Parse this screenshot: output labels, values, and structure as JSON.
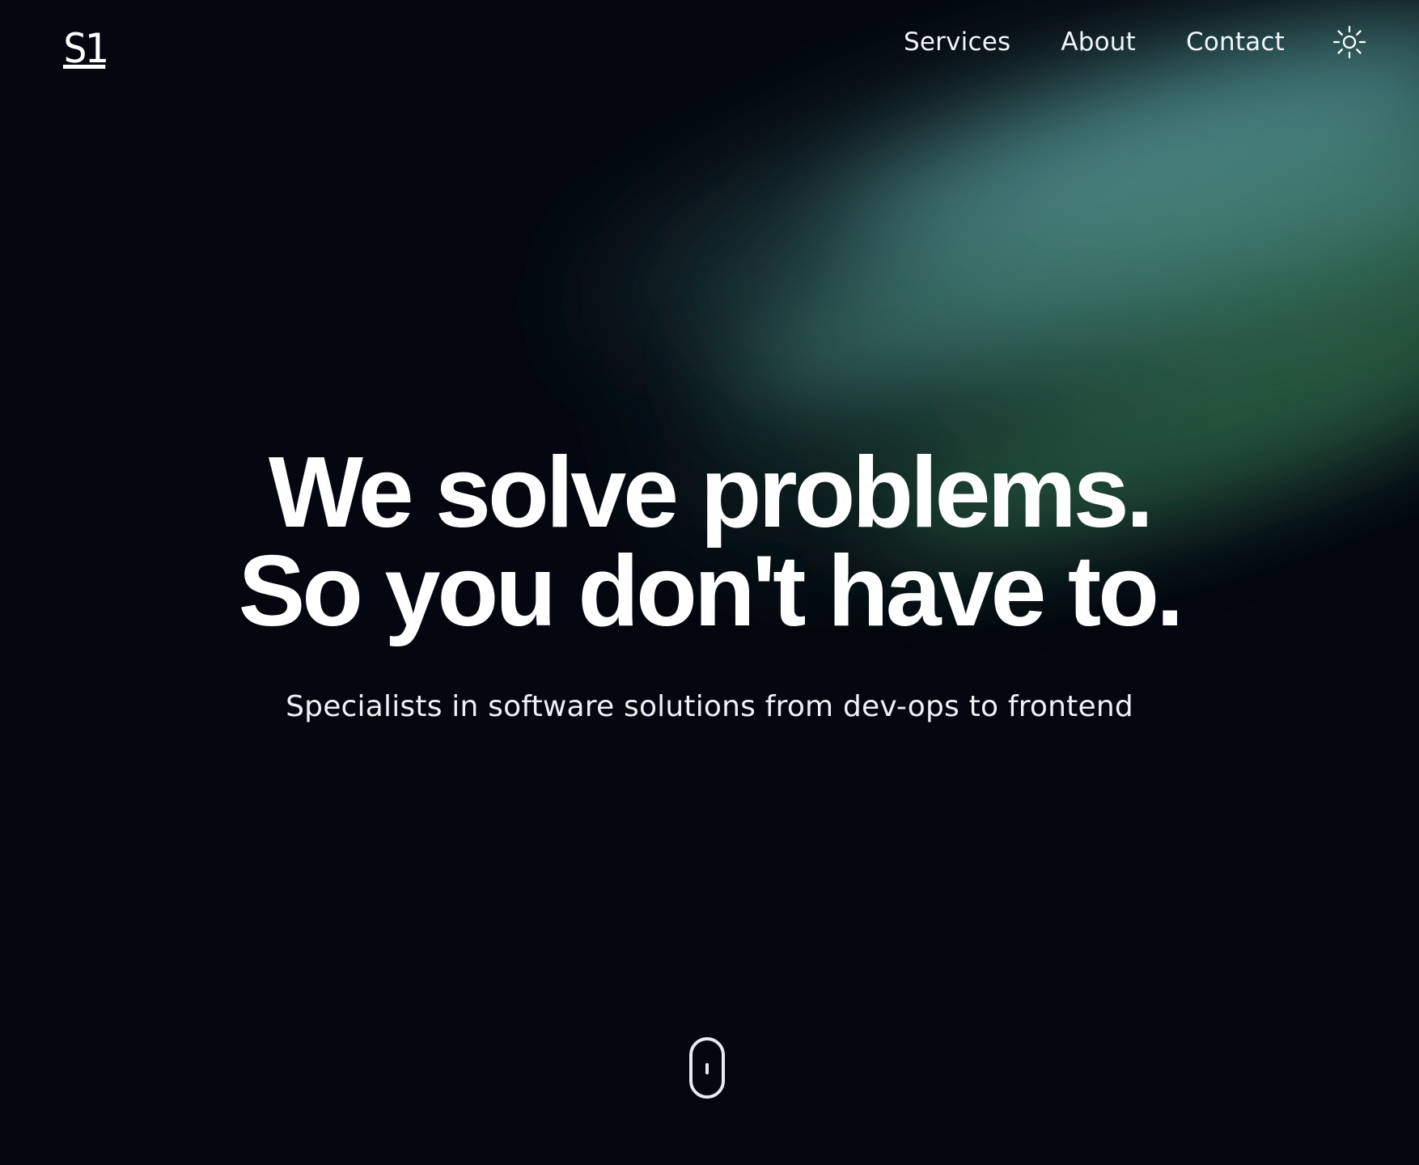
{
  "header": {
    "logo": "S1",
    "nav": [
      {
        "label": "Services"
      },
      {
        "label": "About"
      },
      {
        "label": "Contact"
      }
    ],
    "theme_toggle_icon": "sun-icon"
  },
  "hero": {
    "headline_line_1": "We solve problems.",
    "headline_line_2": "So you don't have to.",
    "subheadline": "Specialists in software solutions from dev-ops to frontend"
  },
  "scroll_indicator": {
    "icon": "mouse-scroll-icon"
  },
  "colors": {
    "background": "#04070f",
    "aurora_teal": "#3f7b7b",
    "aurora_green": "#2f6547",
    "text": "#ffffff",
    "logo_accent": "#7fcfe9"
  }
}
